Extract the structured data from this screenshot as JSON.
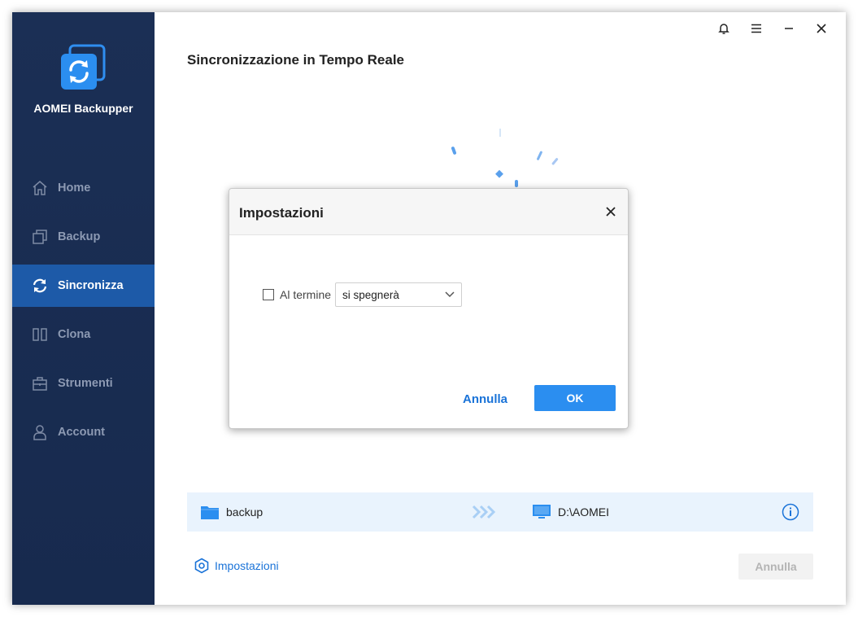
{
  "app": {
    "name": "AOMEI Backupper"
  },
  "sidebar": {
    "items": [
      {
        "label": "Home",
        "icon": "home-icon"
      },
      {
        "label": "Backup",
        "icon": "backup-icon"
      },
      {
        "label": "Sincronizza",
        "icon": "sync-icon",
        "active": true
      },
      {
        "label": "Clona",
        "icon": "clone-icon"
      },
      {
        "label": "Strumenti",
        "icon": "tools-icon"
      },
      {
        "label": "Account",
        "icon": "account-icon"
      }
    ]
  },
  "header": {
    "title": "Sincronizzazione in Tempo Reale"
  },
  "sync": {
    "source": "backup",
    "destination": "D:\\AOMEI"
  },
  "footer": {
    "settings_label": "Impostazioni",
    "cancel_label": "Annulla"
  },
  "dialog": {
    "title": "Impostazioni",
    "option_label": "Al termine",
    "option_checked": false,
    "select_value": "si spegnerà",
    "cancel_label": "Annulla",
    "ok_label": "OK"
  },
  "colors": {
    "sidebar_bg": "#1b2f55",
    "active_nav": "#1d5aa8",
    "accent": "#2b8ef0",
    "link": "#1a73d8"
  }
}
